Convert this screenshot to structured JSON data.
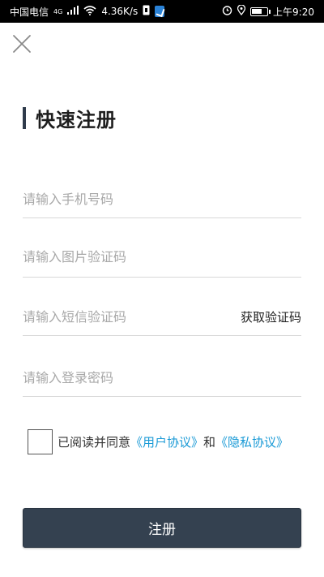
{
  "status_bar": {
    "carrier": "中国电信",
    "network": "4G",
    "speed": "4.36K/s",
    "time": "上午9:20"
  },
  "page": {
    "title": "快速注册",
    "fields": {
      "phone_placeholder": "请输入手机号码",
      "captcha_placeholder": "请输入图片验证码",
      "sms_placeholder": "请输入短信验证码",
      "password_placeholder": "请输入登录密码"
    },
    "sms_button": "获取验证码",
    "agreement": {
      "prefix": "已阅读并同意",
      "user_agreement": "《用户协议》",
      "conjunction": "和",
      "privacy_agreement": "《隐私协议》",
      "checked": false
    },
    "register_button": "注册"
  },
  "colors": {
    "accent": "#344150",
    "link": "#1a9ad6"
  }
}
